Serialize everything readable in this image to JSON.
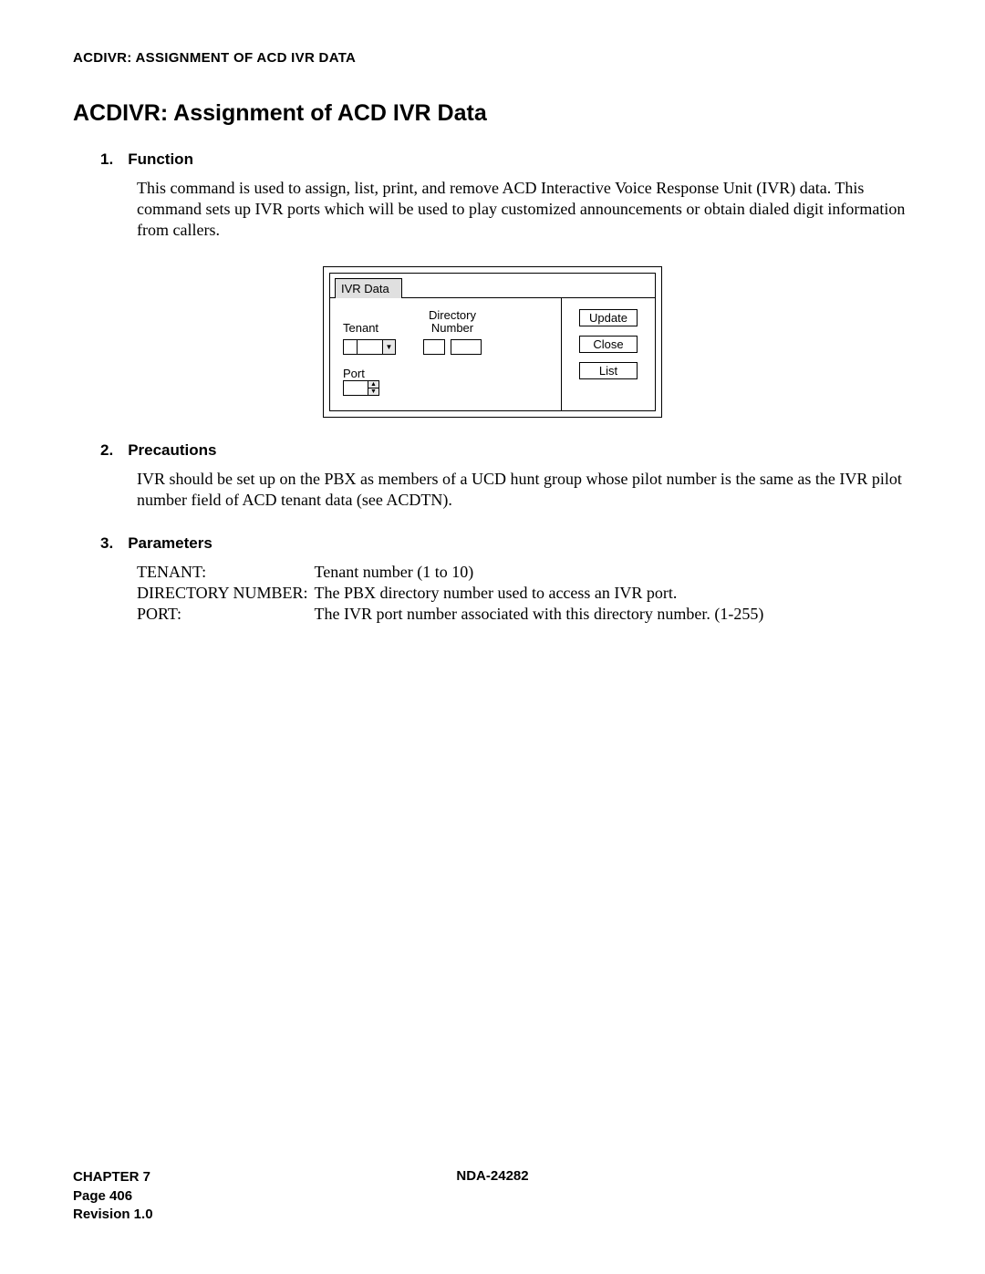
{
  "running_head": "ACDIVR: ASSIGNMENT OF ACD IVR DATA",
  "title": "ACDIVR: Assignment of ACD IVR Data",
  "sections": {
    "s1": {
      "num": "1.",
      "head": "Function",
      "body": "This command is used to assign, list, print, and remove ACD Interactive Voice Response Unit (IVR) data. This command sets up IVR ports which will be used to play customized announcements or obtain dialed digit information from callers."
    },
    "s2": {
      "num": "2.",
      "head": "Precautions",
      "body": "IVR should be set up on the PBX as members of a UCD hunt group whose pilot number is the same as the IVR pilot number field of ACD tenant data (see ACDTN)."
    },
    "s3": {
      "num": "3.",
      "head": "Parameters"
    }
  },
  "parameters": {
    "p1": {
      "label": "TENANT:",
      "desc": "Tenant number (1 to 10)"
    },
    "p2": {
      "label": "DIRECTORY NUMBER:",
      "desc": "The PBX directory number used to access an IVR port."
    },
    "p3": {
      "label": "PORT:",
      "desc": "The IVR port number associated with this directory number. (1-255)"
    }
  },
  "ivr": {
    "tab": "IVR Data",
    "tenant_label": "Tenant",
    "dir_label_line1": "Directory",
    "dir_label_line2": "Number",
    "port_label": "Port",
    "btn_update": "Update",
    "btn_close": "Close",
    "btn_list": "List"
  },
  "footer": {
    "chapter": "CHAPTER 7",
    "page": "Page 406",
    "revision": "Revision 1.0",
    "docnum": "NDA-24282"
  }
}
